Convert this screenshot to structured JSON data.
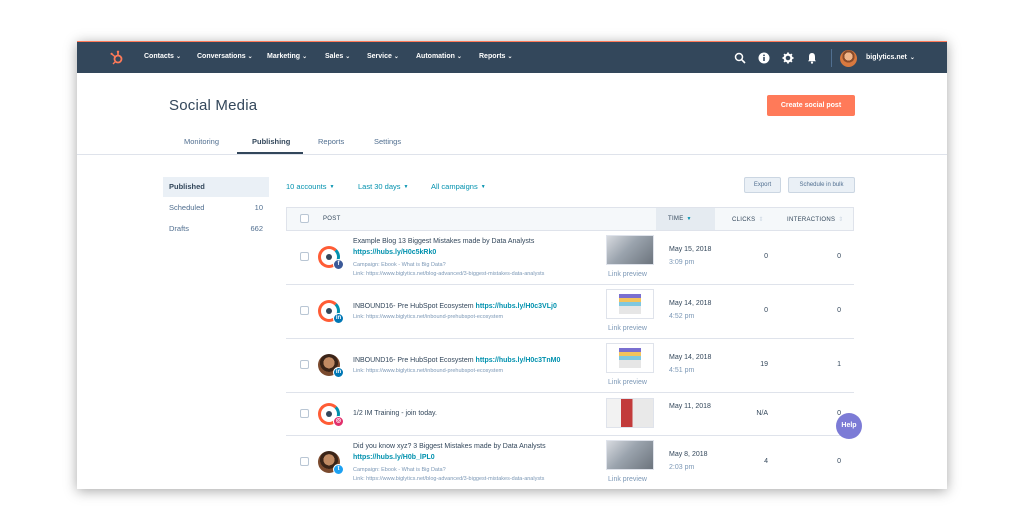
{
  "colors": {
    "nav_bg": "#33475b",
    "accent": "#ff7a59",
    "link": "#0091ae",
    "help": "#7c7bd6"
  },
  "nav": {
    "items": [
      "Contacts",
      "Conversations",
      "Marketing",
      "Sales",
      "Service",
      "Automation",
      "Reports"
    ],
    "account": "biglytics.net",
    "icons": [
      "search-icon",
      "help-icon",
      "gear-icon",
      "bell-icon"
    ]
  },
  "page": {
    "title": "Social Media",
    "create_label": "Create social post"
  },
  "tabs": [
    "Monitoring",
    "Publishing",
    "Reports",
    "Settings"
  ],
  "sidebar": [
    {
      "label": "Published",
      "count": ""
    },
    {
      "label": "Scheduled",
      "count": "10"
    },
    {
      "label": "Drafts",
      "count": "662"
    }
  ],
  "filters": {
    "accounts": "10 accounts",
    "range": "Last 30 days",
    "campaigns": "All campaigns"
  },
  "actions": {
    "export": "Export",
    "schedule_bulk": "Schedule in bulk"
  },
  "table": {
    "headers": {
      "post": "POST",
      "time": "TIME",
      "clicks": "CLICKS",
      "interactions": "INTERACTIONS"
    },
    "rows": [
      {
        "text": "Example Blog 13 Biggest Mistakes made by Data Analysts ",
        "link": "https://hubs.ly/H0c5kRk0",
        "campaign": "Campaign: Ebook - What is Big Data?",
        "url": "Link: https://www.biglytics.net/blog-advanced/3-biggest-mistakes-data-analysts",
        "network": "facebook",
        "preview": "Link preview",
        "date": "May 15, 2018",
        "time": "3:09 pm",
        "clicks": "0",
        "interactions": "0"
      },
      {
        "text": "INBOUND16- Pre HubSpot Ecosystem ",
        "link": "https://hubs.ly/H0c3VLj0",
        "campaign": "",
        "url": "Link: https://www.biglytics.net/inbound-prehubspot-ecosystem",
        "network": "linkedin",
        "preview": "Link preview",
        "date": "May 14, 2018",
        "time": "4:52 pm",
        "clicks": "0",
        "interactions": "0"
      },
      {
        "text": "INBOUND16- Pre HubSpot Ecosystem ",
        "link": "https://hubs.ly/H0c3TnM0",
        "campaign": "",
        "url": "Link: https://www.biglytics.net/inbound-prehubspot-ecosystem",
        "network": "linkedin",
        "preview": "Link preview",
        "date": "May 14, 2018",
        "time": "4:51 pm",
        "clicks": "19",
        "interactions": "1"
      },
      {
        "text": "1/2 IM Training - join today.",
        "link": "",
        "campaign": "",
        "url": "",
        "network": "instagram",
        "preview": "",
        "date": "May 11, 2018",
        "time": "",
        "clicks": "N/A",
        "interactions": "0"
      },
      {
        "text": "Did you know xyz? 3 Biggest Mistakes made by Data Analysts ",
        "link": "https://hubs.ly/H0b_lPL0",
        "campaign": "Campaign: Ebook - What is Big Data?",
        "url": "Link: https://www.biglytics.net/blog-advanced/3-biggest-mistakes-data-analysts",
        "network": "twitter",
        "preview": "Link preview",
        "date": "May 8, 2018",
        "time": "2:03 pm",
        "clicks": "4",
        "interactions": "0"
      }
    ]
  },
  "help_label": "Help"
}
